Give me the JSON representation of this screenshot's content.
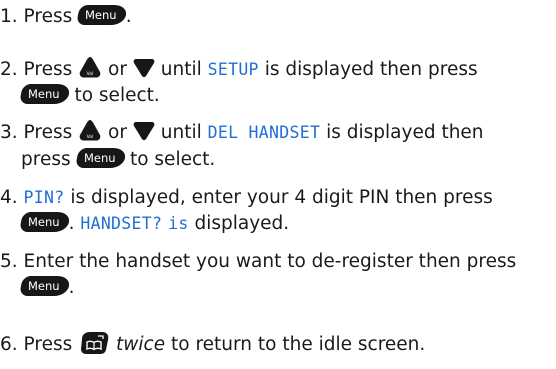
{
  "colors": {
    "lcd_text": "#1f6fd6",
    "button_bg": "#171717"
  },
  "buttons": {
    "menu": "Menu",
    "vol": "Vol"
  },
  "steps": [
    {
      "num": "1.",
      "a": "Press",
      "b": "."
    },
    {
      "num": "2.",
      "a": "Press",
      "b": "or",
      "c": "until",
      "lcd": "SETUP",
      "d": "is displayed then press",
      "e": "to select."
    },
    {
      "num": "3.",
      "a": "Press",
      "b": "or",
      "c": "until",
      "lcd": "DEL HANDSET",
      "d": "is displayed then",
      "e": "press",
      "f": "to select."
    },
    {
      "num": "4.",
      "lcd": "PIN?",
      "a": "is displayed, enter your 4 digit PIN then press",
      "b": ".",
      "lcd2": "HANDSET?",
      "lcd3": "is",
      "c": "displayed."
    },
    {
      "num": "5.",
      "a": "Enter the handset you want to de-register then press",
      "b": "."
    },
    {
      "num": "6.",
      "a": "Press",
      "em": "twice",
      "b": "to return to the idle screen."
    }
  ]
}
